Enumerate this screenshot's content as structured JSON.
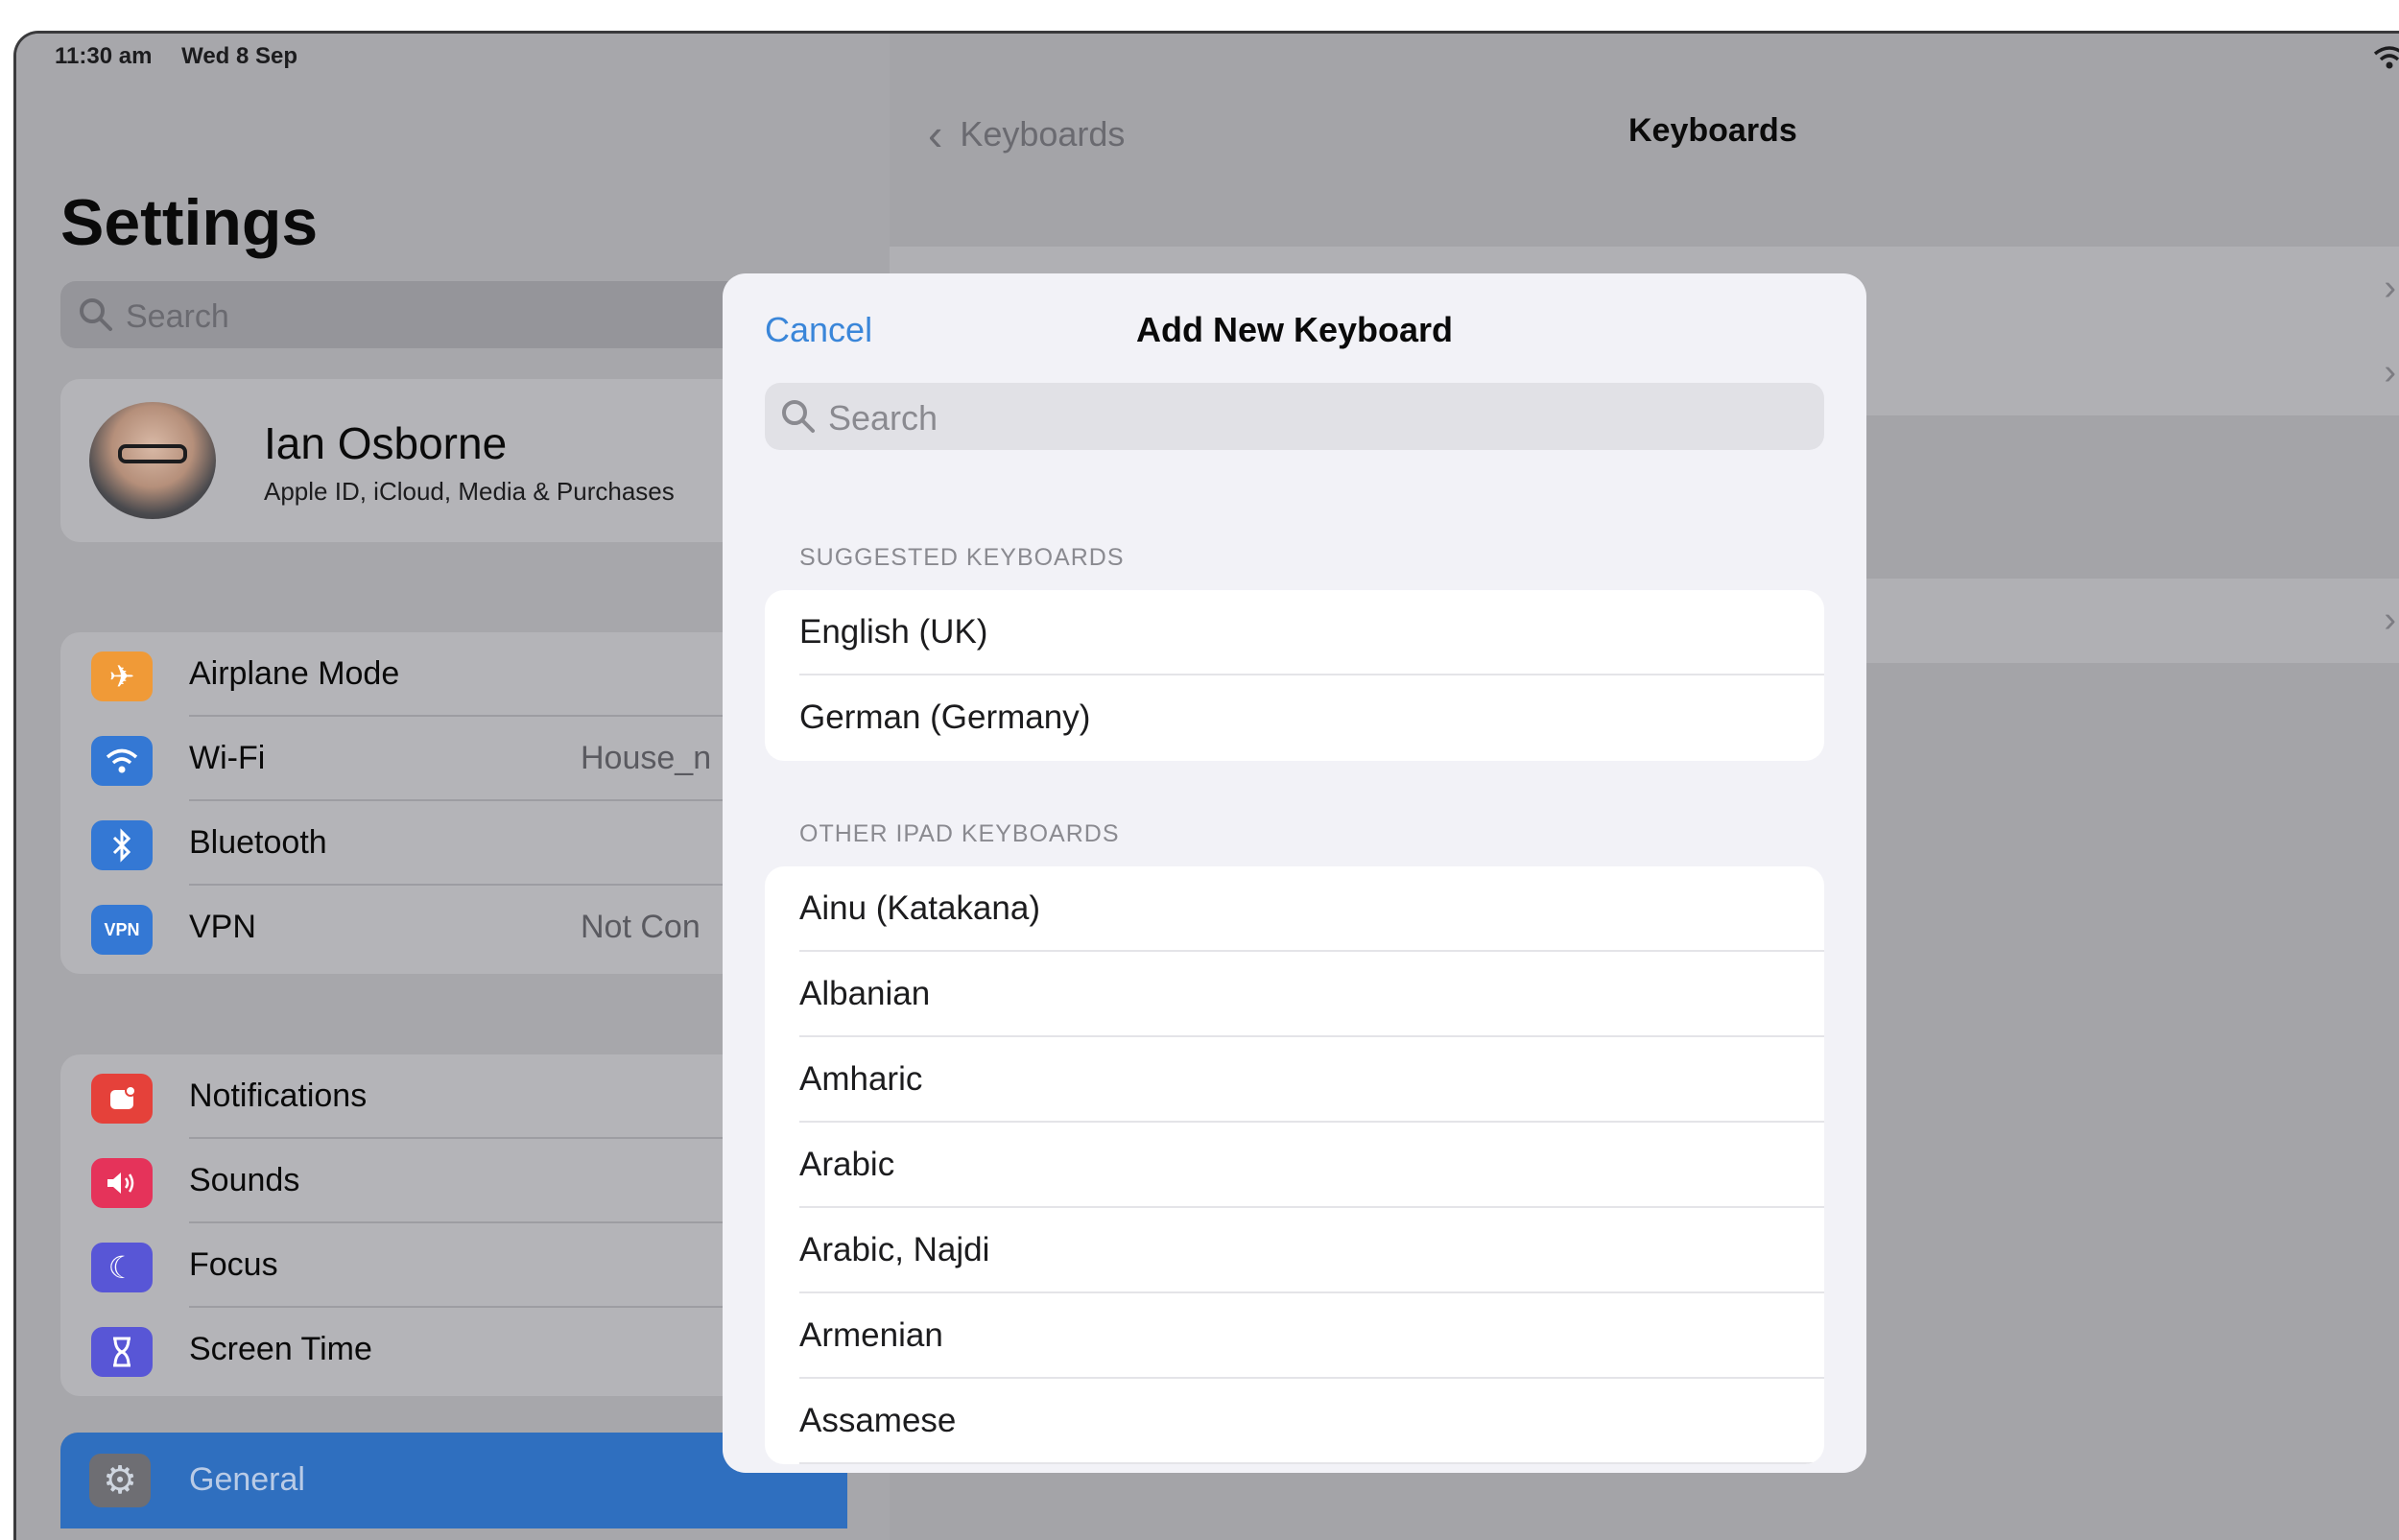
{
  "status": {
    "time": "11:30 am",
    "date": "Wed 8 Sep"
  },
  "sidebar": {
    "title": "Settings",
    "search_placeholder": "Search",
    "profile": {
      "name": "Ian Osborne",
      "subtitle": "Apple ID, iCloud, Media & Purchases"
    },
    "connectivity": [
      {
        "label": "Airplane Mode",
        "value": "",
        "icon": "airplane-icon",
        "color": "#f09a37",
        "glyph": "✈"
      },
      {
        "label": "Wi-Fi",
        "value": "House_n",
        "icon": "wifi-icon",
        "color": "#3478d4",
        "glyph": "◔"
      },
      {
        "label": "Bluetooth",
        "value": "",
        "icon": "bluetooth-icon",
        "color": "#3478d4",
        "glyph": "✱"
      },
      {
        "label": "VPN",
        "value": "Not Con",
        "icon": "vpn-icon",
        "color": "#3478d4",
        "glyph": "VPN"
      }
    ],
    "notifications": [
      {
        "label": "Notifications",
        "icon": "notifications-icon",
        "color": "#e5413a",
        "glyph": "◘"
      },
      {
        "label": "Sounds",
        "icon": "sounds-icon",
        "color": "#e5335a",
        "glyph": "◀"
      },
      {
        "label": "Focus",
        "icon": "focus-moon-icon",
        "color": "#5856d6",
        "glyph": "☾"
      },
      {
        "label": "Screen Time",
        "icon": "hourglass-icon",
        "color": "#5856d6",
        "glyph": "⧗"
      }
    ],
    "general": {
      "label": "General",
      "icon": "gear-icon",
      "glyph": "⚙"
    }
  },
  "detail": {
    "back_label": "Keyboards",
    "title": "Keyboards"
  },
  "modal": {
    "cancel": "Cancel",
    "title": "Add New Keyboard",
    "search_placeholder": "Search",
    "suggested_header": "SUGGESTED KEYBOARDS",
    "suggested": [
      "English (UK)",
      "German (Germany)"
    ],
    "other_header": "OTHER IPAD KEYBOARDS",
    "other": [
      "Ainu (Katakana)",
      "Albanian",
      "Amharic",
      "Arabic",
      "Arabic, Najdi",
      "Armenian",
      "Assamese"
    ]
  },
  "colors": {
    "accent": "#3a86d9",
    "general_selected": "#2f6fbf"
  }
}
